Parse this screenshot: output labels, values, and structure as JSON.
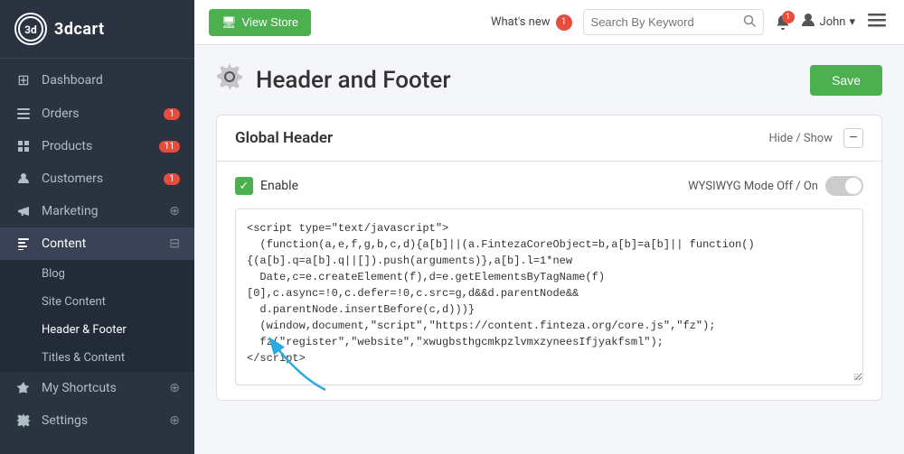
{
  "sidebar": {
    "logo": {
      "icon_text": "3",
      "name": "3dcart"
    },
    "nav_items": [
      {
        "id": "dashboard",
        "label": "Dashboard",
        "icon": "⊞",
        "badge": null,
        "badge_type": null,
        "has_plus": false
      },
      {
        "id": "orders",
        "label": "Orders",
        "icon": "☰",
        "badge": "1",
        "badge_type": "red",
        "has_plus": false
      },
      {
        "id": "products",
        "label": "Products",
        "icon": "◈",
        "badge": "11",
        "badge_type": "red",
        "has_plus": false
      },
      {
        "id": "customers",
        "label": "Customers",
        "icon": "♟",
        "badge": "1",
        "badge_type": "red",
        "has_plus": false
      },
      {
        "id": "marketing",
        "label": "Marketing",
        "icon": "📣",
        "badge": null,
        "badge_type": null,
        "has_plus": true
      },
      {
        "id": "content",
        "label": "Content",
        "icon": "📄",
        "badge": null,
        "badge_type": null,
        "has_plus": false,
        "expanded": true
      },
      {
        "id": "my-shortcuts",
        "label": "My Shortcuts",
        "icon": "☆",
        "badge": null,
        "badge_type": null,
        "has_plus": true
      },
      {
        "id": "settings",
        "label": "Settings",
        "icon": "⚙",
        "badge": null,
        "badge_type": null,
        "has_plus": true
      }
    ],
    "sub_items": [
      {
        "id": "blog",
        "label": "Blog"
      },
      {
        "id": "site-content",
        "label": "Site Content"
      },
      {
        "id": "header-footer",
        "label": "Header & Footer",
        "active": true
      },
      {
        "id": "titles-content",
        "label": "Titles & Content"
      }
    ]
  },
  "topbar": {
    "view_store_label": "View Store",
    "view_store_icon": "🖥",
    "whats_new_label": "What's new",
    "whats_new_badge": "1",
    "search_placeholder": "Search By Keyword",
    "notification_badge": "1",
    "user_name": "John",
    "user_caret": "▾"
  },
  "page": {
    "title": "Header and Footer",
    "gear_icon": "⚙",
    "save_label": "Save"
  },
  "global_header_card": {
    "title": "Global Header",
    "hide_show_label": "Hide / Show",
    "collapse_icon": "−",
    "enable_label": "Enable",
    "wysiwyg_label": "WYSIWYG Mode Off / On",
    "code_content": "<script type=\"text/javascript\">\n  (function(a,e,f,g,b,c,d){a[b]||(a.FintezaCoreObject=b,a[b]=a[b]|| function(){(a[b].q=a[b].q||[]).push(arguments)},a[b].l=1*new\n  Date,c=e.createElement(f),d=e.getElementsByTagName(f)[0],c.async=!0,c.defer=!0,c.src=g,d&&d.parentNode&&\n  d.parentNode.insertBefore(c,d)))}\n  (window,document,\"script\",\"https://content.finteza.org/core.js\",\"fz\");\n  fz(\"register\",\"website\",\"xwugbsthgcmkpzlvmxzyneesIfjyakfsml\");\n<\\/script>"
  }
}
